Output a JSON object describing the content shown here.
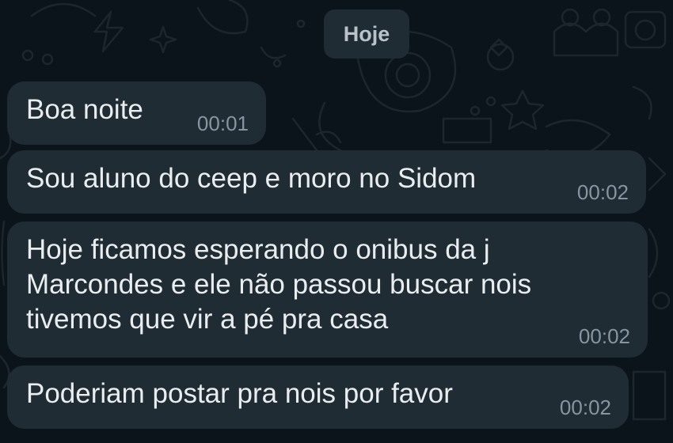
{
  "date_separator": "Hoje",
  "messages": [
    {
      "text": "Boa noite",
      "time": "00:01"
    },
    {
      "text": "Sou aluno do ceep e moro no Sidom",
      "time": "00:02"
    },
    {
      "text": "Hoje ficamos esperando o onibus da j\nMarcondes e ele não passou buscar nois\ntivemos que vir a pé pra casa",
      "time": "00:02"
    },
    {
      "text": "Poderiam postar pra nois por favor",
      "time": "00:02"
    }
  ],
  "colors": {
    "background": "#0b141a",
    "bubble": "#202c33",
    "text": "#e9edef",
    "timestamp": "#8696a0"
  }
}
